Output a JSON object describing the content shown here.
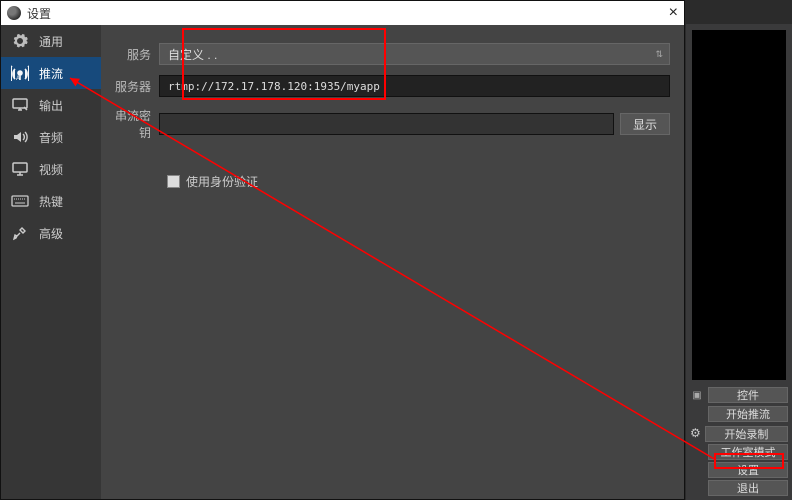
{
  "window": {
    "title": "设置",
    "close": "×"
  },
  "sidebar": {
    "items": [
      {
        "label": "通用"
      },
      {
        "label": "推流"
      },
      {
        "label": "输出"
      },
      {
        "label": "音频"
      },
      {
        "label": "视频"
      },
      {
        "label": "热键"
      },
      {
        "label": "高级"
      }
    ]
  },
  "form": {
    "service_label": "服务",
    "service_value": "自定义 . .",
    "server_label": "服务器",
    "server_value": "rtmp://172.17.178.120:1935/myapp",
    "key_label": "串流密钥",
    "key_value": "",
    "show_btn": "显示",
    "auth_checkbox": "使用身份验证"
  },
  "controls": {
    "title": "控件",
    "buttons": [
      "开始推流",
      "开始录制",
      "工作室模式",
      "设置",
      "退出"
    ]
  }
}
